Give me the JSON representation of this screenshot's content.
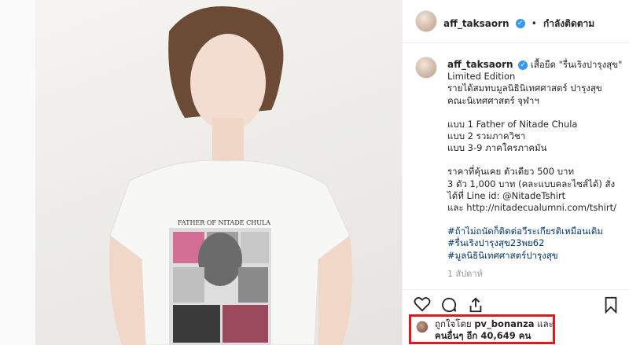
{
  "post": {
    "username": "aff_taksaorn",
    "follow_status": "กำลังติดตาม",
    "shirt_print": "FATHER OF NITADE CHULA",
    "caption_lines": [
      "เสื้อยืด \"รื่นเริงปารุงสุข\"",
      "Limited Edition",
      "รายได้สมทบมูลนิธินิเทศศาสตร์ ปารุงสุข",
      "คณะนิเทศศาสตร์ จุฬาฯ",
      "",
      "แบบ 1 Father of Nitade Chula",
      "แบบ 2 รวมภาควิชา",
      "แบบ 3-9 ภาคใครภาคมัน",
      "",
      "ราคาที่คุ้นเคย ตัวเดียว 500 บาท",
      "3 ตัว 1,000 บาท (คละแบบคละไซส์ได้) สั่ง",
      "ได้ที่ Line id: @NitadeTshirt",
      "และ http://nitadecualumni.com/tshirt/",
      "",
      "#ถ้าไม่ถนัดก็ติดต่อวีระเกียรติเหมือนเดิม",
      "#รื่นเริงปารุงสุข23พย62",
      "#มูลนิธินิเทศศาสตร์ปารุงสุข"
    ],
    "likes_meta": "1 สัปดาห์",
    "liked_by_prefix": "ถูกใจโดย",
    "liked_by_user": "pv_bonanza",
    "liked_by_and": "และ",
    "liked_by_others": "คนอื่นๆ อีก 40,649 คน"
  },
  "icons": {
    "verified": "verified-badge-icon",
    "like": "heart-icon",
    "comment": "comment-icon",
    "share": "share-icon",
    "save": "bookmark-icon",
    "next": "chevron-right-icon"
  },
  "colors": {
    "accent": "#3897f0",
    "highlight_box": "#e1171e",
    "hashtag": "#003569"
  }
}
